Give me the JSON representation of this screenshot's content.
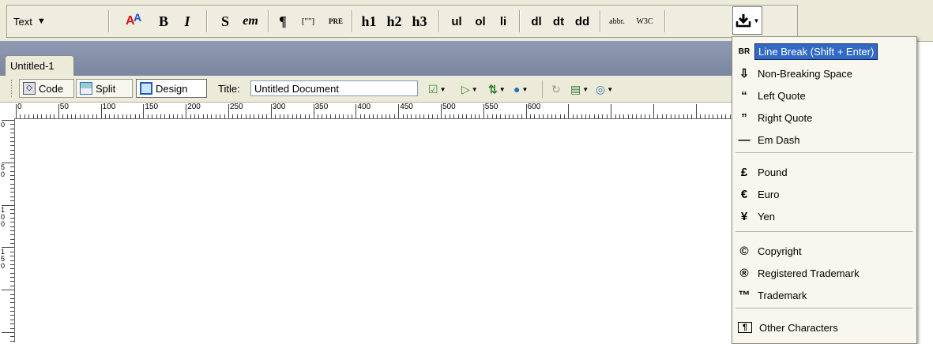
{
  "insertbar": {
    "category": "Text",
    "buttons": {
      "font_tag": "A",
      "bold": "B",
      "italic": "I",
      "strong": "S",
      "em": "em",
      "paragraph": "¶",
      "blockquote": "[\"\"]",
      "pre": "PRE",
      "h1": "h1",
      "h2": "h2",
      "h3": "h3",
      "ul": "ul",
      "ol": "ol",
      "li": "li",
      "dl": "dl",
      "dt": "dt",
      "dd": "dd",
      "abbr": "abbr.",
      "acronym": "W3C"
    }
  },
  "document": {
    "tab": "Untitled-1",
    "views": [
      "Code",
      "Split",
      "Design"
    ],
    "active_view": "Design",
    "title_label": "Title:",
    "title_value": "Untitled Document"
  },
  "ruler": {
    "h_labels": [
      "0",
      "50",
      "100",
      "150",
      "200",
      "250",
      "300",
      "350",
      "400",
      "450",
      "500",
      "550",
      "600"
    ],
    "v_labels": [
      "0",
      "50",
      "100",
      "150"
    ]
  },
  "menu": {
    "items": [
      {
        "icon": "BR",
        "label": "Line Break (Shift + Enter)",
        "selected": true
      },
      {
        "icon": "⇩",
        "label": "Non-Breaking Space"
      },
      {
        "icon": "“",
        "label": "Left Quote"
      },
      {
        "icon": "”",
        "label": "Right Quote"
      },
      {
        "icon": "—",
        "label": "Em Dash"
      },
      {
        "icon": "£",
        "label": "Pound"
      },
      {
        "icon": "€",
        "label": "Euro"
      },
      {
        "icon": "¥",
        "label": "Yen"
      },
      {
        "icon": "©",
        "label": "Copyright"
      },
      {
        "icon": "®",
        "label": "Registered Trademark"
      },
      {
        "icon": "™",
        "label": "Trademark"
      },
      {
        "icon": "¶",
        "label": "Other Characters"
      }
    ]
  },
  "colors": {
    "selection": "#316ac5",
    "panel": "#ecead8",
    "tabstrip": "#8f9bb3"
  }
}
